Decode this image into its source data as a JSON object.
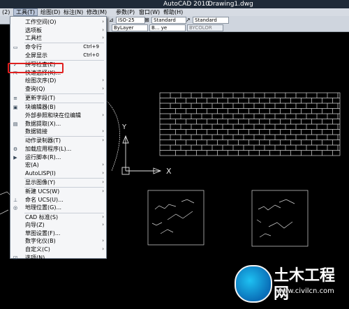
{
  "window": {
    "app": "AutoCAD 2010",
    "file": "Drawing1.dwg"
  },
  "menubar": [
    {
      "label": "(2)"
    },
    {
      "label": "工具(T)"
    },
    {
      "label": "绘图(D)"
    },
    {
      "label": "标注(N)"
    },
    {
      "label": "修改(M)"
    },
    {
      "label": "参数(P)"
    },
    {
      "label": "窗口(W)"
    },
    {
      "label": "帮助(H)"
    }
  ],
  "toolbar": {
    "text_style": "ISO-25",
    "dim_style": "Standard",
    "table_style": "Standard",
    "linetype": "ByLayer",
    "lineweight": "B... ye",
    "plotstyle": "BYCOLOR"
  },
  "tools_menu": {
    "items": [
      {
        "label": "工作空间(O)",
        "shortcut": "",
        "submenu": true,
        "icon": ""
      },
      {
        "label": "选项板",
        "shortcut": "",
        "submenu": true,
        "icon": ""
      },
      {
        "label": "工具栏",
        "shortcut": "",
        "submenu": true,
        "icon": ""
      },
      {
        "label": "命令行",
        "shortcut": "Ctrl+9",
        "submenu": false,
        "icon": "command-line-icon"
      },
      {
        "label": "全屏显示",
        "shortcut": "Ctrl+0",
        "submenu": false,
        "icon": ""
      },
      {
        "label": "拼写检查(E)",
        "shortcut": "",
        "submenu": false,
        "icon": "spell-check-icon"
      },
      {
        "label": "快速选择(K)...",
        "shortcut": "",
        "submenu": false,
        "icon": "quick-select-icon"
      },
      {
        "label": "绘图次序(D)",
        "shortcut": "",
        "submenu": true,
        "icon": ""
      },
      {
        "label": "查询(Q)",
        "shortcut": "",
        "submenu": true,
        "icon": ""
      },
      {
        "label": "更新字段(T)",
        "shortcut": "",
        "submenu": false,
        "icon": "update-field-icon"
      },
      {
        "label": "块编辑器(B)",
        "shortcut": "",
        "submenu": false,
        "icon": "block-editor-icon"
      },
      {
        "label": "外部参照和块在位编辑",
        "shortcut": "",
        "submenu": true,
        "icon": ""
      },
      {
        "label": "数据提取(X)...",
        "shortcut": "",
        "submenu": false,
        "icon": "data-extraction-icon"
      },
      {
        "label": "数据链接",
        "shortcut": "",
        "submenu": true,
        "icon": ""
      },
      {
        "label": "动作录制器(T)",
        "shortcut": "",
        "submenu": true,
        "icon": ""
      },
      {
        "label": "加载应用程序(L)...",
        "shortcut": "",
        "submenu": false,
        "icon": "load-app-icon"
      },
      {
        "label": "运行脚本(R)...",
        "shortcut": "",
        "submenu": false,
        "icon": "run-script-icon"
      },
      {
        "label": "宏(A)",
        "shortcut": "",
        "submenu": true,
        "icon": ""
      },
      {
        "label": "AutoLISP(I)",
        "shortcut": "",
        "submenu": true,
        "icon": ""
      },
      {
        "label": "显示图像(Y)",
        "shortcut": "",
        "submenu": true,
        "icon": ""
      },
      {
        "label": "新建 UCS(W)",
        "shortcut": "",
        "submenu": true,
        "icon": ""
      },
      {
        "label": "命名 UCS(U)...",
        "shortcut": "",
        "submenu": false,
        "icon": "named-ucs-icon"
      },
      {
        "label": "地理位置(G)...",
        "shortcut": "",
        "submenu": false,
        "icon": "geo-location-icon"
      },
      {
        "label": "CAD 标准(S)",
        "shortcut": "",
        "submenu": true,
        "icon": ""
      },
      {
        "label": "向导(Z)",
        "shortcut": "",
        "submenu": true,
        "icon": ""
      },
      {
        "label": "草图设置(F)...",
        "shortcut": "",
        "submenu": false,
        "icon": ""
      },
      {
        "label": "数字化仪(B)",
        "shortcut": "",
        "submenu": true,
        "icon": ""
      },
      {
        "label": "自定义(C)",
        "shortcut": "",
        "submenu": true,
        "icon": ""
      },
      {
        "label": "选项(N)...",
        "shortcut": "",
        "submenu": false,
        "icon": "options-icon"
      }
    ]
  },
  "ucs": {
    "x_label": "X",
    "y_label": "Y"
  },
  "watermark": {
    "title": "土木工程网",
    "url": "www.civilcn.com"
  },
  "colors": {
    "canvas": "#000000",
    "highlight": "#e0201f",
    "menu_bg": "#f5f6f8"
  }
}
